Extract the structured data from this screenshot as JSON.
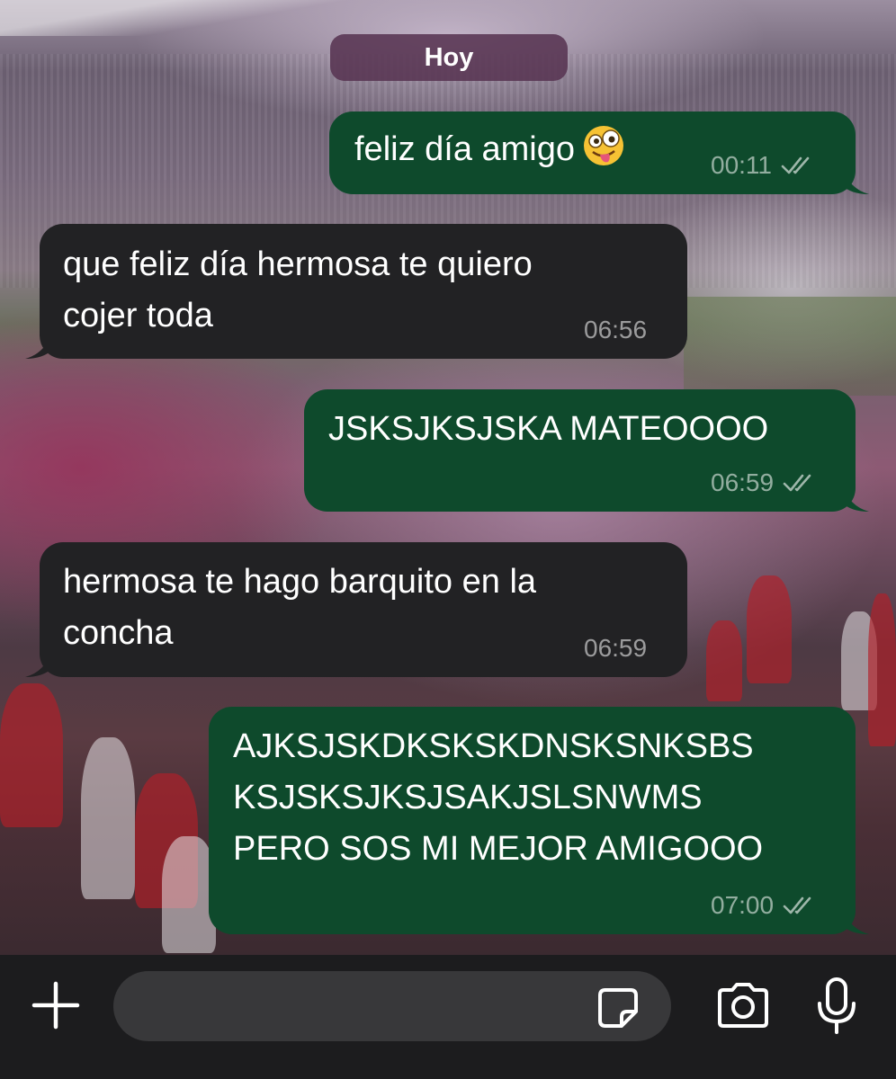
{
  "chat": {
    "date_label": "Hoy",
    "messages": [
      {
        "direction": "outgoing",
        "lines": [
          "feliz día amigo"
        ],
        "emoji": "zany-face",
        "time": "00:11",
        "status": "read"
      },
      {
        "direction": "incoming",
        "lines": [
          "que feliz día hermosa te quiero",
          "cojer toda"
        ],
        "time": "06:56"
      },
      {
        "direction": "outgoing",
        "lines": [
          "JSKSJKSJSKA MATEOOOO"
        ],
        "time": "06:59",
        "status": "read"
      },
      {
        "direction": "incoming",
        "lines": [
          "hermosa te hago barquito en la",
          "concha"
        ],
        "time": "06:59"
      },
      {
        "direction": "outgoing",
        "lines": [
          "AJKSJSKDKSKSKDNSKSNKSBS",
          "KSJSKSJKSJSAKJSLSNWMS",
          "PERO SOS MI MEJOR AMIGOOO"
        ],
        "time": "07:00",
        "status": "read"
      }
    ]
  },
  "composer": {
    "placeholder": "",
    "icons": [
      "plus-icon",
      "sticker-icon",
      "camera-icon",
      "microphone-icon"
    ]
  },
  "colors": {
    "outgoing_bubble": "#0e4a2c",
    "incoming_bubble": "#222224",
    "date_chip": "#583452",
    "composer_bg": "#1c1c1e",
    "input_bg": "#38383a"
  }
}
